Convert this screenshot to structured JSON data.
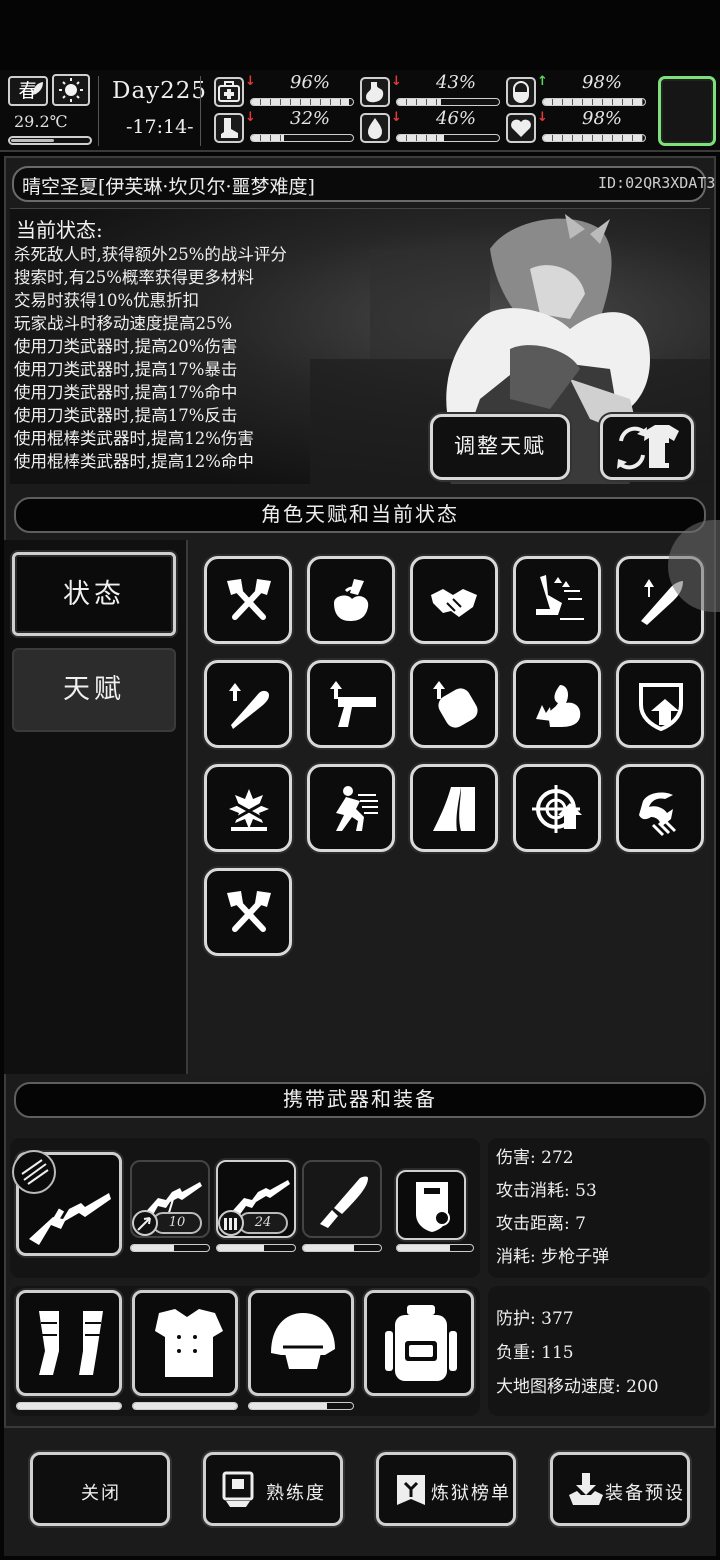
{
  "top_bar": {
    "season": "春",
    "temperature": "29.2℃",
    "temperature_level": 0.55,
    "day": "Day225",
    "time": "-17:14-",
    "stats": [
      {
        "name": "health",
        "icon": "medkit-icon",
        "trend": "down",
        "value": "96%",
        "level": 0.96
      },
      {
        "name": "hunger",
        "icon": "stomach-icon",
        "trend": "down",
        "value": "43%",
        "level": 0.43
      },
      {
        "name": "mood",
        "icon": "pill-icon",
        "trend": "up",
        "value": "98%",
        "level": 0.98
      },
      {
        "name": "stamina",
        "icon": "boot-icon",
        "trend": "down",
        "value": "32%",
        "level": 0.32
      },
      {
        "name": "thirst",
        "icon": "water-drop-icon",
        "trend": "down",
        "value": "46%",
        "level": 0.46
      },
      {
        "name": "spirit",
        "icon": "heart-icon",
        "trend": "down",
        "value": "98%",
        "level": 0.98
      }
    ],
    "colors": {
      "up": "#5fd35b",
      "down": "#e53935",
      "slot_border": "#7ee07a"
    }
  },
  "character": {
    "name": "晴空圣夏[伊芙琳·坎贝尔·噩梦难度]",
    "id": "ID:02QR3XDAT3"
  },
  "current_state": {
    "title": "当前状态:",
    "lines": [
      "杀死敌人时,获得额外25%的战斗评分",
      "搜索时,有25%概率获得更多材料",
      "交易时获得10%优惠折扣",
      "玩家战斗时移动速度提高25%",
      "使用刀类武器时,提高20%伤害",
      "使用刀类武器时,提高17%暴击",
      "使用刀类武器时,提高17%命中",
      "使用刀类武器时,提高17%反击",
      "使用棍棒类武器时,提高12%伤害",
      "使用棍棒类武器时,提高12%命中"
    ]
  },
  "buttons": {
    "adjust_talent": "调整天赋",
    "outfit_icon": "outfit-swap-icon"
  },
  "sections": {
    "talent_section": "角色天赋和当前状态",
    "equipment_section": "携带武器和装备"
  },
  "tabs": [
    {
      "label": "状态",
      "active": true
    },
    {
      "label": "天赋",
      "active": false
    }
  ],
  "talents": [
    "crossed-axes-icon",
    "loot-bag-icon",
    "handshake-icon",
    "speed-run-icon",
    "blade-up-icon",
    "club-up-icon",
    "pistol-up-icon",
    "fist-up-icon",
    "muscle-icon",
    "shield-up-icon",
    "explosion-crown-icon",
    "dash-icon",
    "road-icon",
    "target-up-icon",
    "claw-icon",
    "crossed-axes-icon"
  ],
  "weapons": {
    "main": {
      "icon": "assault-rifle-icon",
      "badge_icon": "slash-badge-icon"
    },
    "slots": [
      {
        "icon": "machine-gun-icon",
        "ammo": "10",
        "ammo_icon": "arrow-ammo-icon",
        "durability": 0.55,
        "selected": false
      },
      {
        "icon": "rifle-icon",
        "ammo": "24",
        "ammo_icon": "bullets-icon",
        "durability": 0.6,
        "selected": true
      },
      {
        "icon": "knife-icon",
        "ammo": "",
        "durability": 0.65,
        "selected": false
      },
      {
        "icon": "riot-shield-icon",
        "ammo": "",
        "durability": 0.7,
        "selected": false
      }
    ]
  },
  "weapon_stats": {
    "damage": "伤害: 272",
    "attack_cost": "攻击消耗: 53",
    "attack_range": "攻击距离: 7",
    "consume": "消耗: 步枪子弹"
  },
  "armor": [
    {
      "icon": "gauntlets-icon",
      "durability": 1.0
    },
    {
      "icon": "body-armor-icon",
      "durability": 1.0
    },
    {
      "icon": "helmet-icon",
      "durability": 0.75
    },
    {
      "icon": "backpack-icon",
      "durability": null
    }
  ],
  "armor_stats": {
    "defense": "防护: 377",
    "weight": "负重: 115",
    "map_speed": "大地图移动速度:  200"
  },
  "footer": {
    "close": "关闭",
    "proficiency": "熟练度",
    "purgatory_rank": "炼狱榜单",
    "equip_preset": "装备预设"
  }
}
